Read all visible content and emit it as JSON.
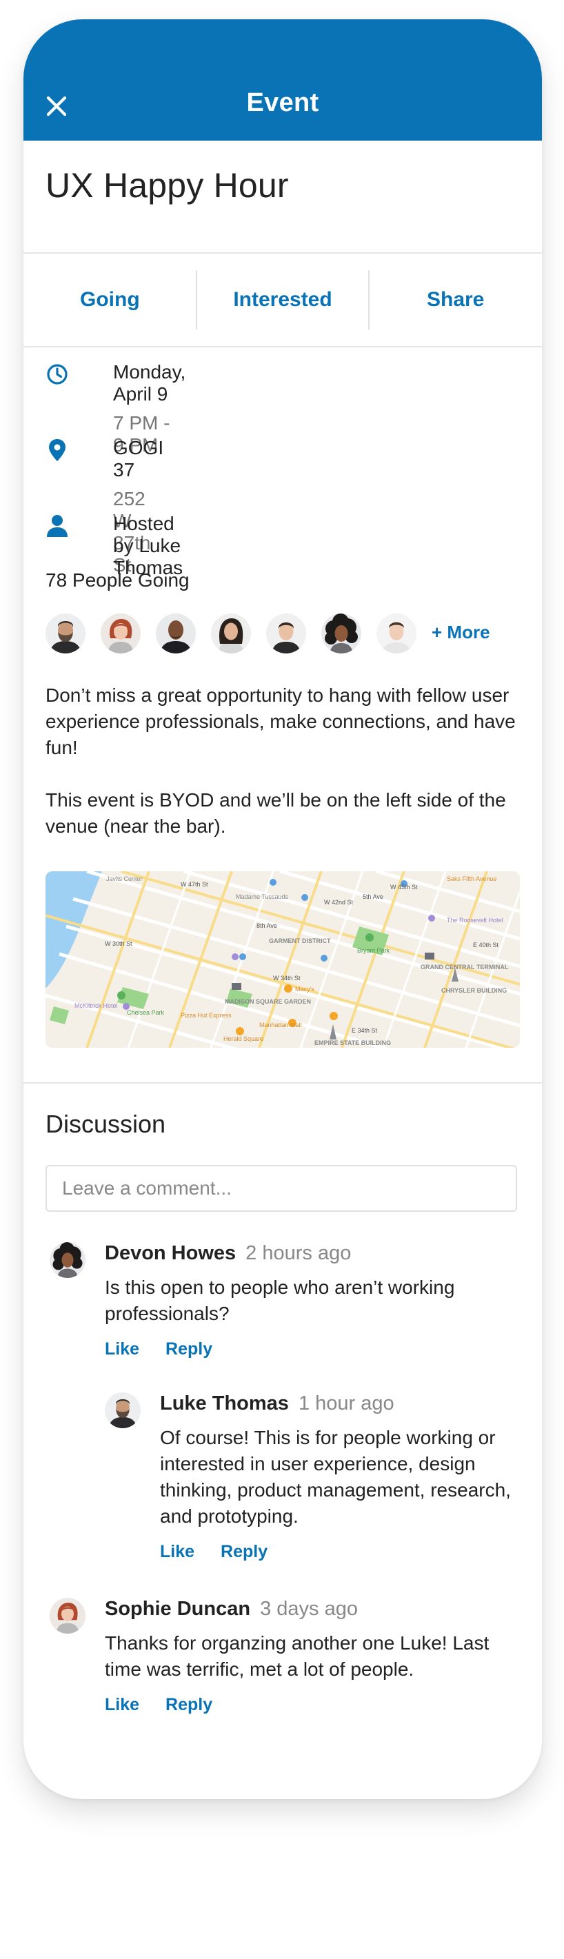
{
  "appbar": {
    "title": "Event",
    "close_icon": "close-icon"
  },
  "event": {
    "title": "UX Happy Hour"
  },
  "actions": {
    "going": "Going",
    "interested": "Interested",
    "share": "Share"
  },
  "details": {
    "date": "Monday, April 9",
    "time": "7 PM - 9 PM",
    "venue": "GOGI 37",
    "address": "252 W 37th St",
    "host": "Hosted by Luke Thomas"
  },
  "attendance": {
    "label": "78 People Going",
    "more": "+ More"
  },
  "description": {
    "p1": "Don’t miss a great opportunity to hang with fellow user experience professionals, make connections, and have fun!",
    "p2": "This event is BYOD and we’ll be on the left side of the venue (near the bar)."
  },
  "map": {
    "labels": {
      "javits": "Javits Center",
      "madame": "Madame Tussauds",
      "saks": "Saks Fifth Avenue",
      "roosevelt": "The Roosevelt Hotel",
      "garment": "GARMENT DISTRICT",
      "bryant": "Bryant Park",
      "grand": "GRAND CENTRAL TERMINAL",
      "chrysler": "CHRYSLER BUILDING",
      "macys": "Macy's",
      "msg": "MADISON SQUARE GARDEN",
      "chelsea": "Chelsea Park",
      "mckittrick": "McKittrick Hotel",
      "pizza": "Pizza Hut Express",
      "manhattan": "Manhattan Mall",
      "herald": "Herald Square",
      "empire": "EMPIRE STATE BUILDING",
      "w30": "W 30th St",
      "w34": "W 34th St",
      "e34": "E 34th St",
      "w42": "W 42nd St",
      "ave8": "8th Ave",
      "ave5": "5th Ave",
      "w47": "W 47th St",
      "w45": "W 45th St",
      "e40": "E 40th St"
    }
  },
  "discussion": {
    "title": "Discussion",
    "placeholder": "Leave a comment...",
    "comments": [
      {
        "name": "Devon Howes",
        "time": "2 hours ago",
        "text": "Is this open to people who aren’t working professionals?",
        "like": "Like",
        "reply": "Reply"
      },
      {
        "name": "Luke Thomas",
        "time": "1 hour ago",
        "text": "Of course! This is for people working or interested in user experience, design thinking, product management, research, and prototyping.",
        "like": "Like",
        "reply": "Reply"
      },
      {
        "name": "Sophie Duncan",
        "time": "3 days ago",
        "text": "Thanks for organzing another one Luke! Last time was terrific, met a lot of people.",
        "like": "Like",
        "reply": "Reply"
      }
    ]
  },
  "colors": {
    "brand": "#0a73b5",
    "text": "#222222",
    "muted": "#777777"
  },
  "icons": [
    "close-icon",
    "clock-icon",
    "location-pin-icon",
    "person-icon"
  ]
}
